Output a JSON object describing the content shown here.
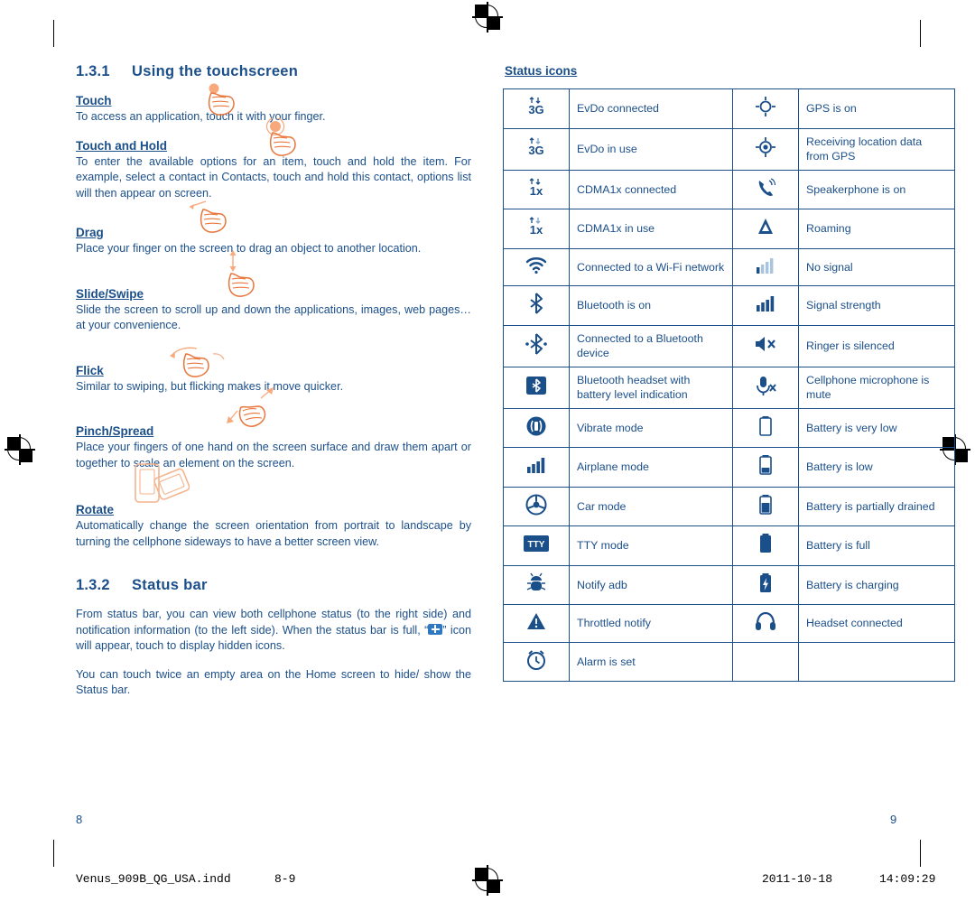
{
  "left": {
    "section1": {
      "number": "1.3.1",
      "title": "Using the touchscreen"
    },
    "items": [
      {
        "heading": "Touch",
        "text": "To access an application, touch it with your finger.",
        "icon": "hand-touch-icon"
      },
      {
        "heading": "Touch and Hold",
        "text": "To enter the available options for an item, touch and hold the item. For example, select a contact in Contacts, touch and hold this contact, options list will then appear on screen.",
        "icon": "hand-touch-hold-icon"
      },
      {
        "heading": "Drag",
        "text": "Place your finger on the screen to drag an object to another location.",
        "icon": "hand-drag-icon"
      },
      {
        "heading": "Slide/Swipe",
        "text": "Slide the screen to scroll up and down the applications, images, web pages… at your convenience.",
        "icon": "hand-slide-icon"
      },
      {
        "heading": "Flick",
        "text": "Similar to swiping, but flicking makes it move quicker.",
        "icon": "hand-flick-icon"
      },
      {
        "heading": "Pinch/Spread",
        "text": "Place your fingers of one hand on the screen surface and draw them apart or together to scale an element on the screen.",
        "icon": "hand-pinch-spread-icon"
      },
      {
        "heading": "Rotate",
        "text": "Automatically change the screen orientation from portrait to landscape by turning the cellphone sideways to have a better screen view.",
        "icon": "phone-rotate-icon"
      }
    ],
    "section2": {
      "number": "1.3.2",
      "title": "Status bar"
    },
    "paragraphs": [
      "From status bar, you can view both cellphone status (to the right side) and notification information (to the left side). When the status bar is full, “",
      "” icon will appear, touch to display hidden icons.",
      "You can touch twice an empty area on the Home screen to hide/ show the Status bar."
    ],
    "page_number": "8"
  },
  "right": {
    "title": "Status icons",
    "rows": [
      {
        "icon_left": "evdo-connected-icon",
        "label_left": "EvDo connected",
        "icon_right": "gps-on-icon",
        "label_right": "GPS is on"
      },
      {
        "icon_left": "evdo-in-use-icon",
        "label_left": "EvDo in use",
        "icon_right": "gps-location-icon",
        "label_right": "Receiving location data from GPS"
      },
      {
        "icon_left": "cdma1x-connected-icon",
        "label_left": "CDMA1x connected",
        "icon_right": "speakerphone-icon",
        "label_right": "Speakerphone is on"
      },
      {
        "icon_left": "cdma1x-in-use-icon",
        "label_left": "CDMA1x in use",
        "icon_right": "roaming-icon",
        "label_right": "Roaming"
      },
      {
        "icon_left": "wifi-icon",
        "label_left": "Connected to a Wi-Fi network",
        "icon_right": "no-signal-icon",
        "label_right": "No signal"
      },
      {
        "icon_left": "bluetooth-on-icon",
        "label_left": "Bluetooth is on",
        "icon_right": "signal-strength-icon",
        "label_right": "Signal strength"
      },
      {
        "icon_left": "bluetooth-connected-icon",
        "label_left": "Connected to a Bluetooth device",
        "icon_right": "ringer-silenced-icon",
        "label_right": "Ringer is silenced"
      },
      {
        "icon_left": "bluetooth-headset-icon",
        "label_left": "Bluetooth headset with battery level indication",
        "icon_right": "mic-mute-icon",
        "label_right": "Cellphone microphone is mute"
      },
      {
        "icon_left": "vibrate-mode-icon",
        "label_left": "Vibrate mode",
        "icon_right": "battery-very-low-icon",
        "label_right": "Battery is very low"
      },
      {
        "icon_left": "airplane-mode-icon",
        "label_left": "Airplane mode",
        "icon_right": "battery-low-icon",
        "label_right": "Battery is low"
      },
      {
        "icon_left": "car-mode-icon",
        "label_left": "Car mode",
        "icon_right": "battery-partial-icon",
        "label_right": "Battery is partially drained"
      },
      {
        "icon_left": "tty-mode-icon",
        "label_left": "TTY mode",
        "icon_right": "battery-full-icon",
        "label_right": "Battery is full"
      },
      {
        "icon_left": "notify-adb-icon",
        "label_left": "Notify adb",
        "icon_right": "battery-charging-icon",
        "label_right": "Battery is charging"
      },
      {
        "icon_left": "throttled-notify-icon",
        "label_left": "Throttled notify",
        "icon_right": "headset-connected-icon",
        "label_right": "Headset connected"
      },
      {
        "icon_left": "alarm-set-icon",
        "label_left": "Alarm is set",
        "icon_right": "",
        "label_right": ""
      }
    ],
    "page_number": "9"
  },
  "footer": {
    "filename": "Venus_909B_QG_USA.indd",
    "pages": "8-9",
    "date": "2011-10-18",
    "time": "14:09:29"
  },
  "colors": {
    "ink": "#1b4f8a",
    "accent_orange": "#f5a06a",
    "black": "#000000"
  }
}
